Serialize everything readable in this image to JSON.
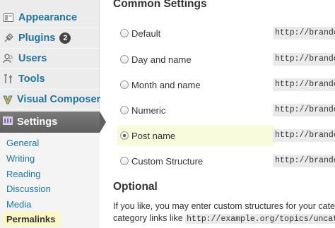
{
  "sidebar": {
    "items": [
      {
        "label": "Appearance",
        "icon": "appearance-icon"
      },
      {
        "label": "Plugins",
        "icon": "plugins-icon",
        "badge": "2"
      },
      {
        "label": "Users",
        "icon": "users-icon"
      },
      {
        "label": "Tools",
        "icon": "tools-icon"
      },
      {
        "label": "Visual Composer",
        "icon": "visual-composer-icon"
      }
    ],
    "settings": {
      "label": "Settings",
      "icon": "settings-icon"
    },
    "submenu": [
      "General",
      "Writing",
      "Reading",
      "Discussion",
      "Media",
      "Permalinks"
    ]
  },
  "main": {
    "common_heading": "Common Settings",
    "options": [
      {
        "label": "Default",
        "example": "http://brandon"
      },
      {
        "label": "Day and name",
        "example": "http://brandon"
      },
      {
        "label": "Month and name",
        "example": "http://brandon"
      },
      {
        "label": "Numeric",
        "example": "http://brandon"
      },
      {
        "label": "Post name",
        "example": "http://brandon",
        "checked": true
      },
      {
        "label": "Custom Structure",
        "example": "http://brandon"
      }
    ],
    "optional_heading": "Optional",
    "optional_text_1": "If you like, you may enter custom structures for your categor",
    "optional_text_2": "category links like",
    "optional_code": "http://example.org/topics/uncategori"
  },
  "colors": {
    "link": "#21759b",
    "active_menu": "#6b6b6b",
    "highlight": "#fafadc"
  }
}
